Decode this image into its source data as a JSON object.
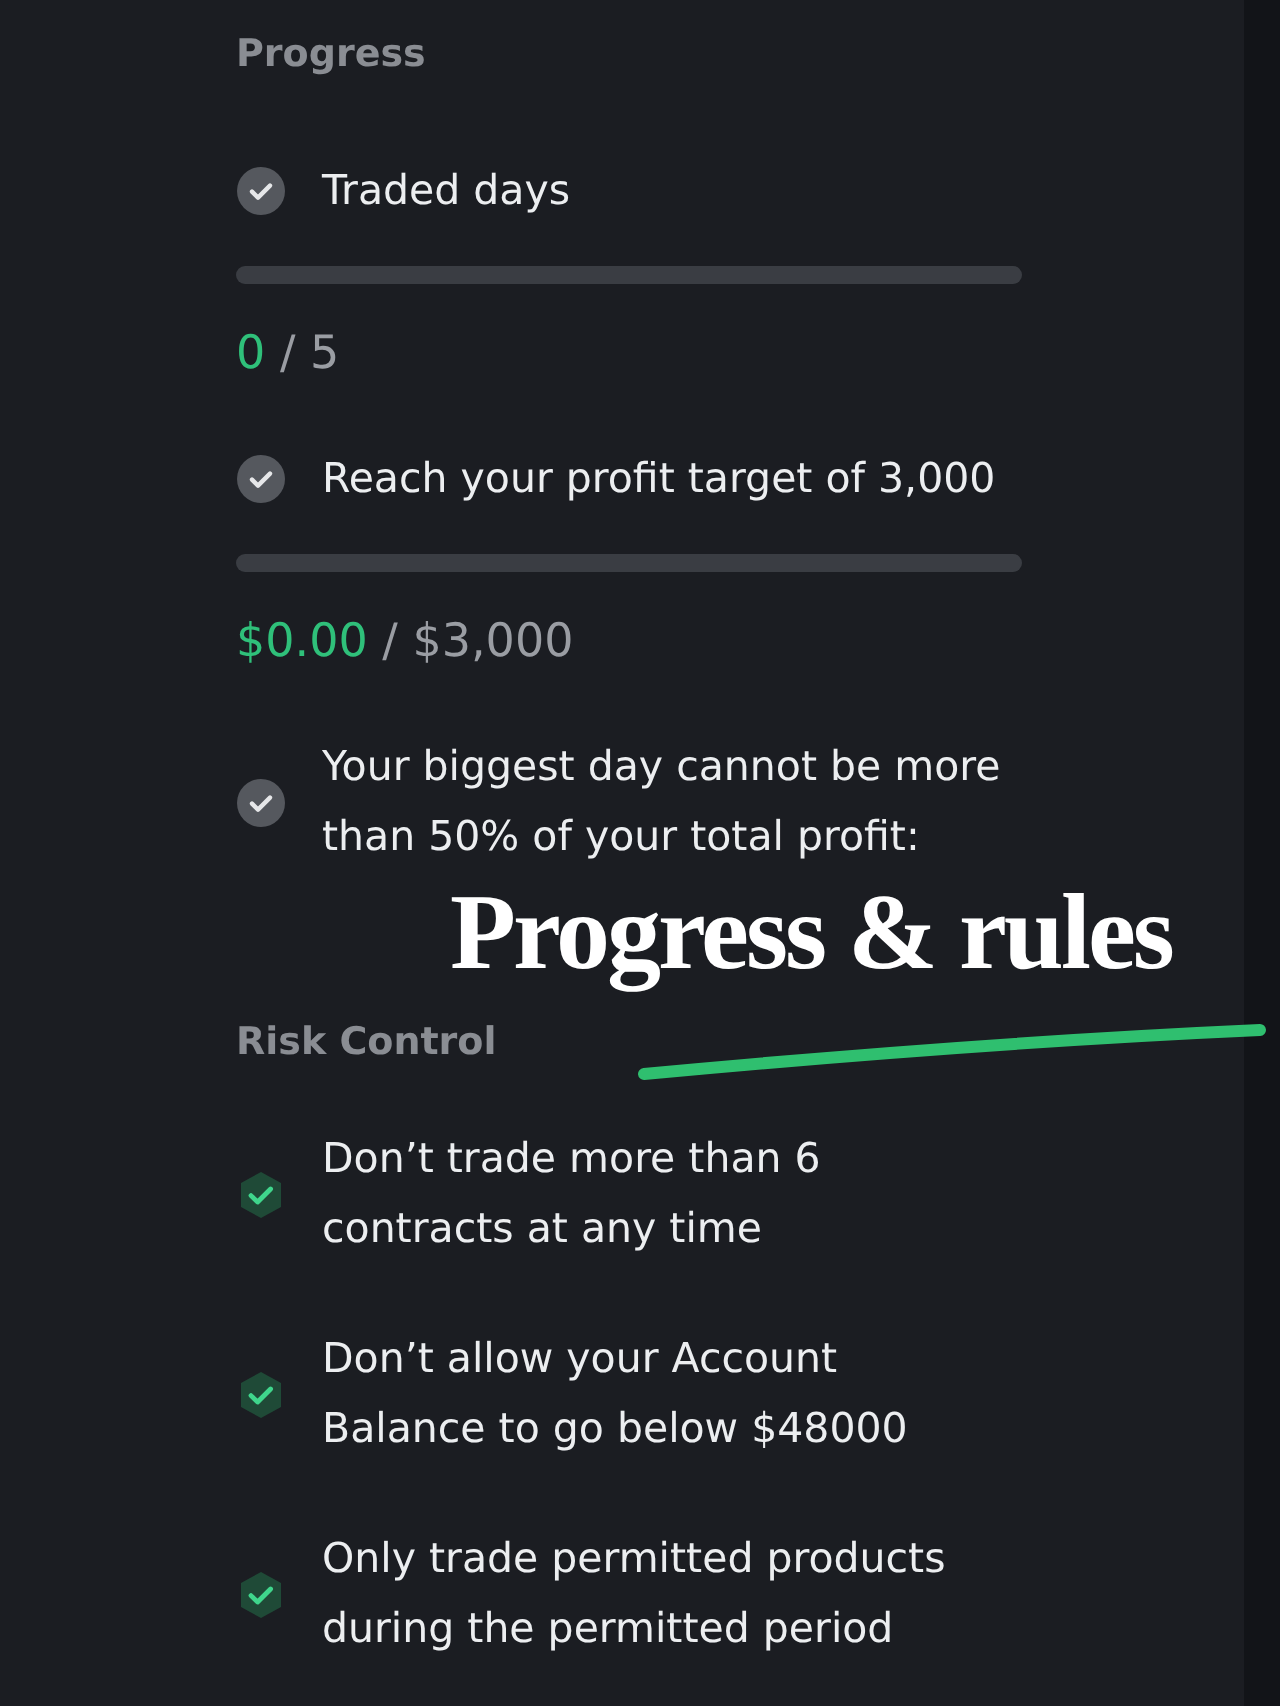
{
  "sections": [
    {
      "title": "Progress",
      "items": [
        {
          "kind": "progress",
          "text": "Traded days",
          "met": false,
          "level": 0,
          "current": "0",
          "rest": "/ 5"
        },
        {
          "kind": "progress",
          "text": "Reach your profit target of 3,000",
          "met": false,
          "level": 0,
          "current": "$0.00",
          "rest": "/ $3,000"
        },
        {
          "kind": "rule",
          "text": "Your biggest day cannot be more than 50% of your total profit:",
          "met": false
        }
      ]
    },
    {
      "title": "Risk Control",
      "items": [
        {
          "kind": "rule",
          "text": "Don’t trade more than 6 contracts at any time",
          "met": true
        },
        {
          "kind": "rule",
          "text": "Don’t allow your Account Balance to go below $48000",
          "met": true
        },
        {
          "kind": "rule",
          "text": "Only trade permitted products during the permitted period",
          "met": true
        }
      ]
    }
  ],
  "caption": {
    "text": "Progress & rules"
  }
}
